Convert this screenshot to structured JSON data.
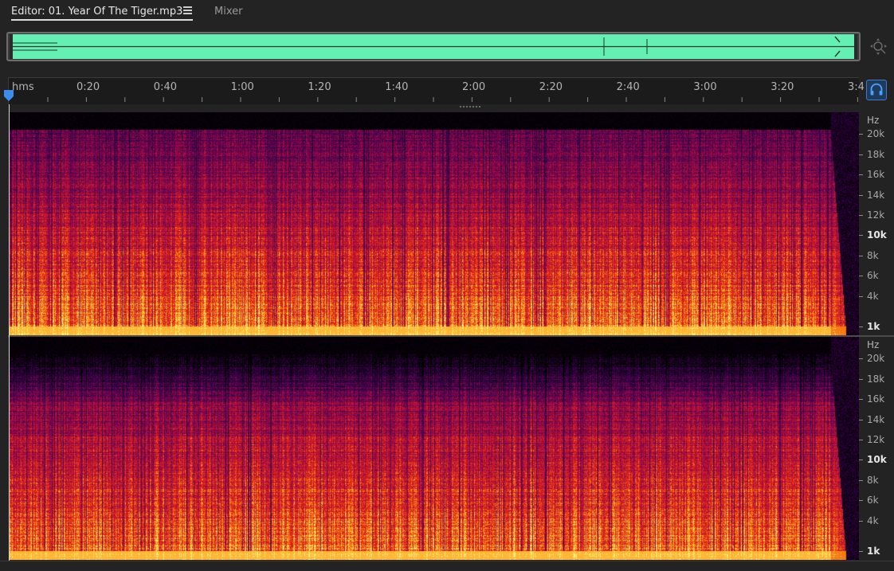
{
  "tabs": {
    "editor_label": "Editor: 01. Year Of The Tiger.mp3",
    "mixer_label": "Mixer"
  },
  "timeline": {
    "unit_label": "hms",
    "ticks": [
      "0:20",
      "0:40",
      "1:00",
      "1:20",
      "1:40",
      "2:00",
      "2:20",
      "2:40",
      "3:00",
      "3:20",
      "3:4"
    ]
  },
  "frequency_scale": {
    "unit": "Hz",
    "labels": [
      "20k",
      "18k",
      "16k",
      "14k",
      "12k",
      "10k",
      "8k",
      "6k",
      "4k",
      "1k"
    ],
    "emphasized": [
      "10k",
      "1k"
    ]
  },
  "colors": {
    "overview_waveform": "#63f0b2",
    "accent": "#3d7ccb",
    "spectrogram_palette": "black-purple-red-orange-yellow"
  },
  "icons": {
    "tab_menu": "hamburger-icon",
    "zoom_navigator": "zoom-navigator-icon",
    "headphones": "headphones-icon",
    "playhead": "playhead-marker-icon"
  }
}
